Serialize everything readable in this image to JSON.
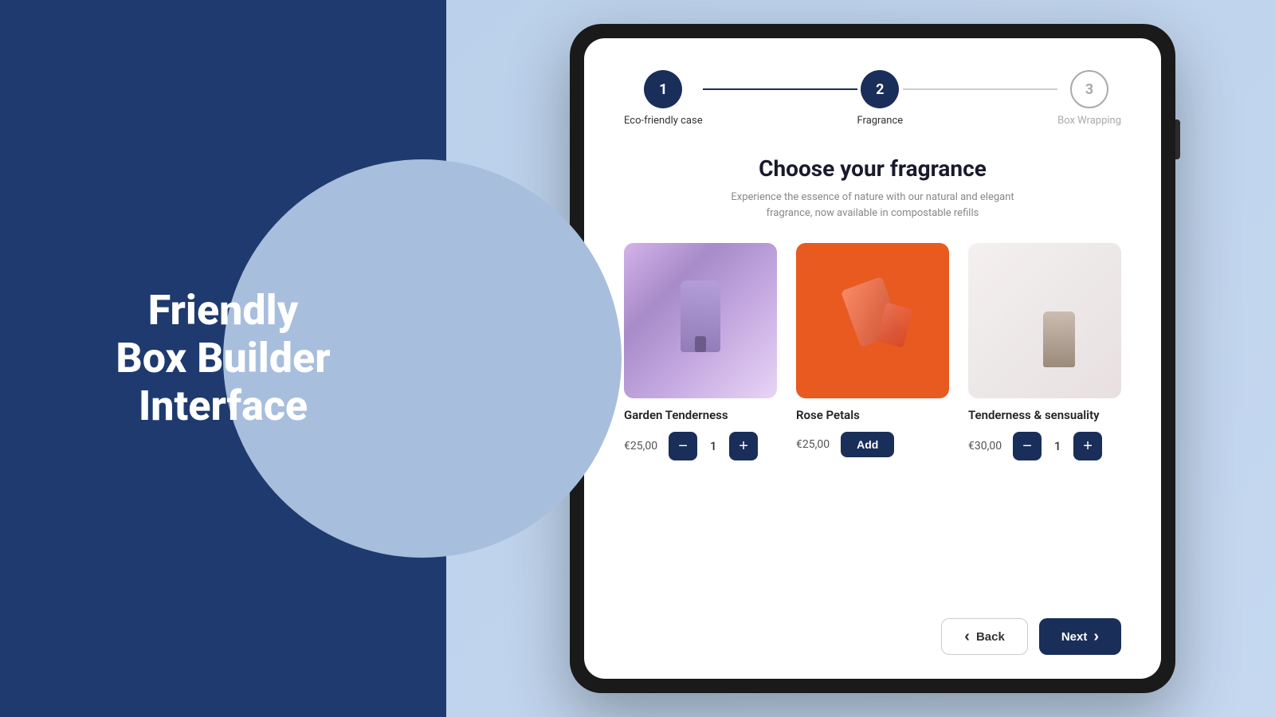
{
  "left": {
    "hero_line1": "Friendly",
    "hero_line2": "Box Builder",
    "hero_line3": "Interface"
  },
  "stepper": {
    "steps": [
      {
        "number": "1",
        "label": "Eco-friendly case",
        "state": "active"
      },
      {
        "number": "2",
        "label": "Fragrance",
        "state": "active"
      },
      {
        "number": "3",
        "label": "Box Wrapping",
        "state": "inactive"
      }
    ],
    "connectors": [
      "done",
      "pending"
    ]
  },
  "page": {
    "title": "Choose your fragrance",
    "subtitle": "Experience the essence of nature with our natural and elegant\nfragrance, now available in compostable refills"
  },
  "products": [
    {
      "id": "garden-tenderness",
      "name": "Garden Tenderness",
      "price": "€25,00",
      "quantity": 1,
      "mode": "qty",
      "img_class": "img-garden"
    },
    {
      "id": "rose-petals",
      "name": "Rose Petals",
      "price": "€25,00",
      "quantity": null,
      "mode": "add",
      "add_label": "Add",
      "img_class": "img-rose"
    },
    {
      "id": "tenderness-sensuality",
      "name": "Tenderness & sensuality",
      "price": "€30,00",
      "quantity": 1,
      "mode": "qty",
      "img_class": "img-tenderness"
    }
  ],
  "footer": {
    "back_label": "Back",
    "next_label": "Next"
  }
}
